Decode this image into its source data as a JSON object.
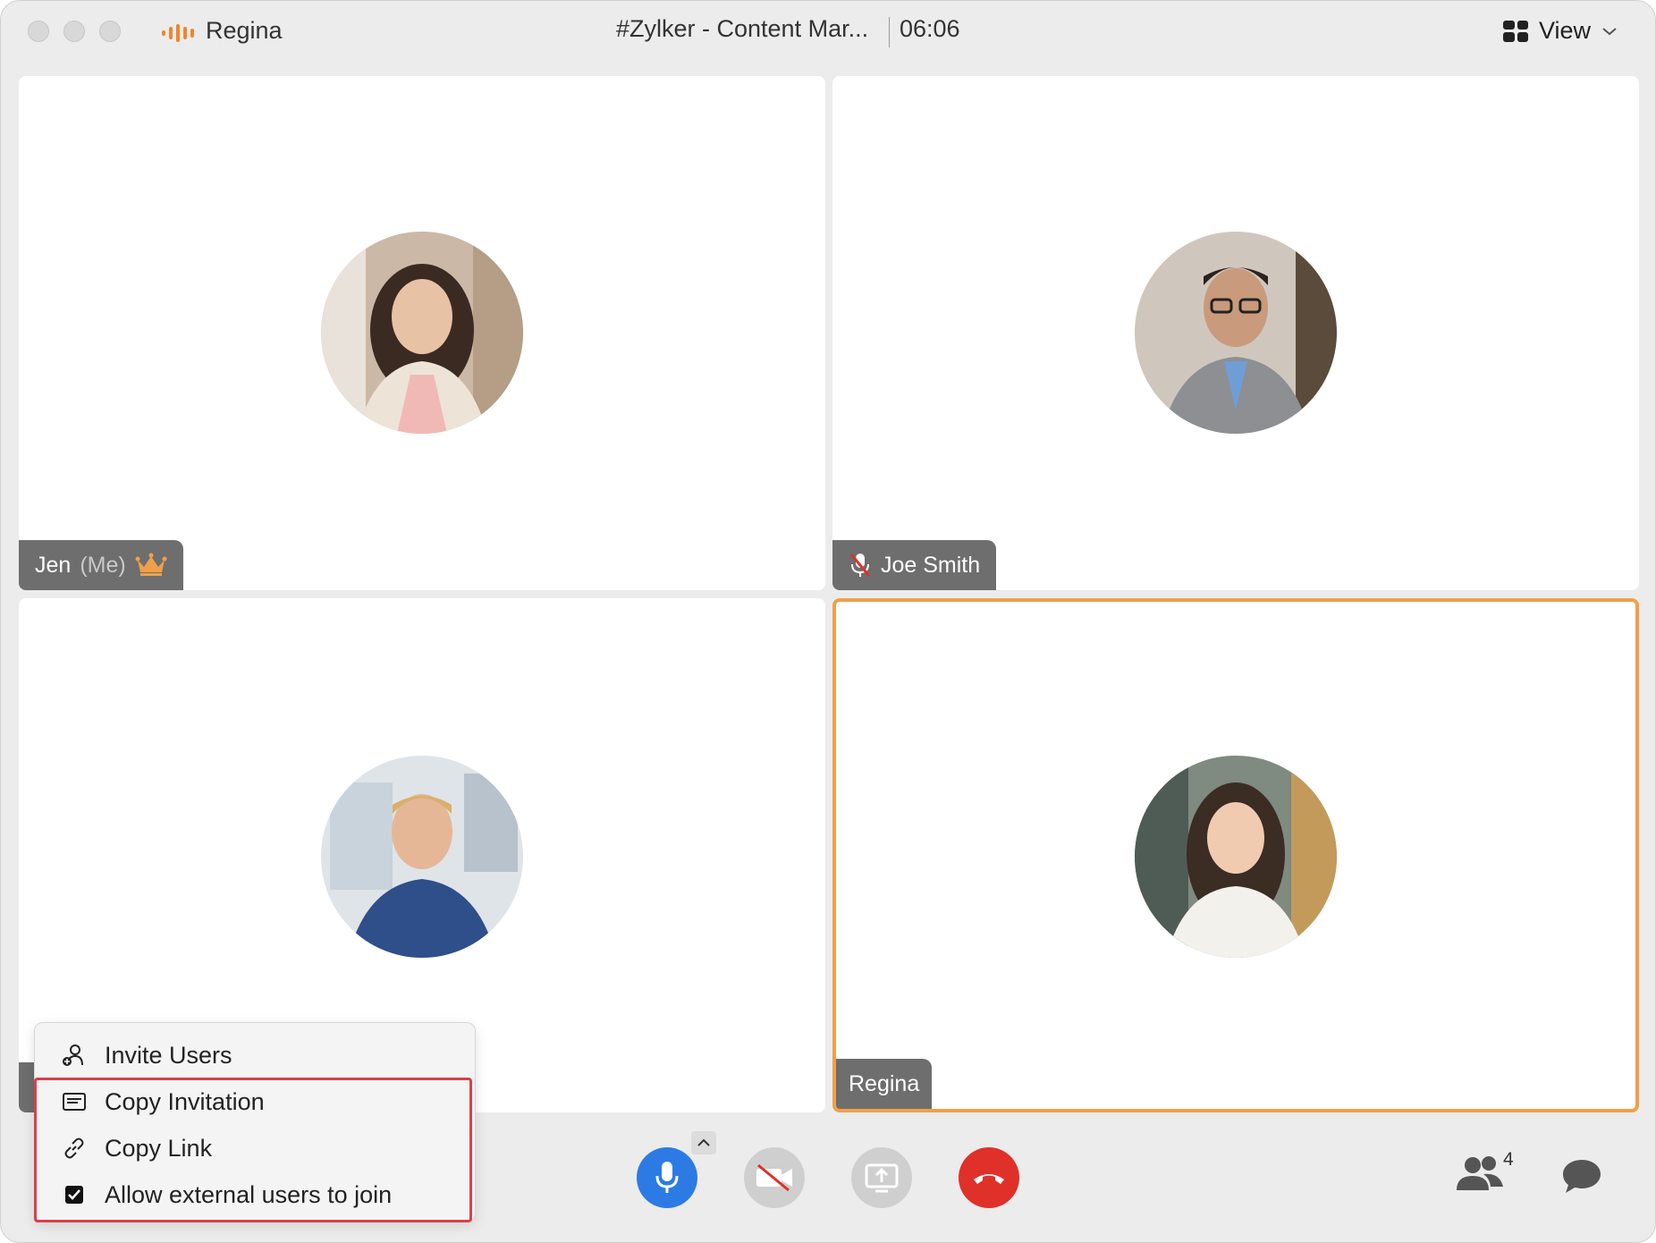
{
  "titlebar": {
    "app_name": "Regina",
    "meeting_title": "#Zylker - Content Mar...",
    "timer": "06:06",
    "view_label": "View"
  },
  "participants": [
    {
      "name": "Jen",
      "suffix": "(Me)",
      "role": "host",
      "muted": false
    },
    {
      "name": "Joe Smith",
      "muted": true
    },
    {
      "name": "",
      "muted": false
    },
    {
      "name": "Regina",
      "muted": false,
      "active_speaker": true
    }
  ],
  "controls": {
    "participant_count": "4"
  },
  "menu": {
    "items": [
      {
        "label": "Invite Users",
        "icon": "invite-user-icon"
      },
      {
        "label": "Copy Invitation",
        "icon": "invitation-card-icon"
      },
      {
        "label": "Copy Link",
        "icon": "link-icon"
      },
      {
        "label": "Allow external users to join",
        "icon": "checkbox-checked",
        "checked": true
      }
    ]
  },
  "colors": {
    "accent_orange": "#f0a04a",
    "mic_blue": "#2c7be5",
    "end_red": "#e0302a",
    "highlight_red": "#d9404a"
  }
}
